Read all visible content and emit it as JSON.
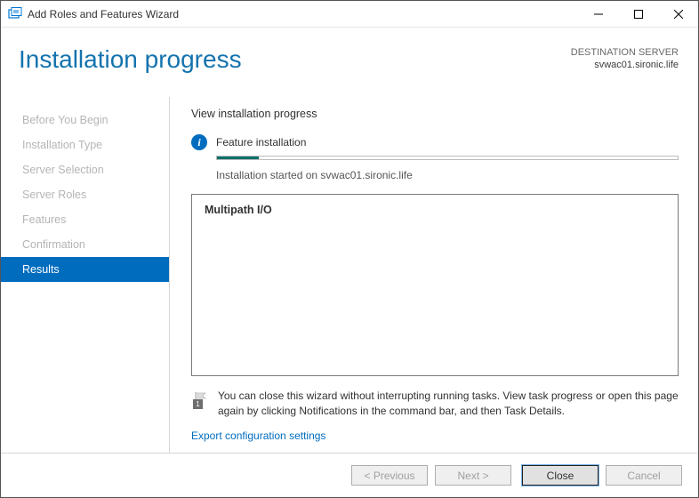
{
  "titlebar": {
    "title": "Add Roles and Features Wizard"
  },
  "header": {
    "title": "Installation progress",
    "destination_label": "DESTINATION SERVER",
    "destination_server": "svwac01.sironic.life"
  },
  "sidebar": {
    "items": [
      {
        "label": "Before You Begin",
        "state": "disabled"
      },
      {
        "label": "Installation Type",
        "state": "disabled"
      },
      {
        "label": "Server Selection",
        "state": "disabled"
      },
      {
        "label": "Server Roles",
        "state": "disabled"
      },
      {
        "label": "Features",
        "state": "disabled"
      },
      {
        "label": "Confirmation",
        "state": "disabled"
      },
      {
        "label": "Results",
        "state": "selected"
      }
    ]
  },
  "content": {
    "heading": "View installation progress",
    "status_title": "Feature installation",
    "progress_percent": 9,
    "status_subtitle": "Installation started on svwac01.sironic.life",
    "details": {
      "items": [
        "Multipath I/O"
      ]
    },
    "note": "You can close this wizard without interrupting running tasks. View task progress or open this page again by clicking Notifications in the command bar, and then Task Details.",
    "note_badge": "1",
    "link": "Export configuration settings"
  },
  "footer": {
    "previous": "< Previous",
    "next": "Next >",
    "close": "Close",
    "cancel": "Cancel"
  }
}
